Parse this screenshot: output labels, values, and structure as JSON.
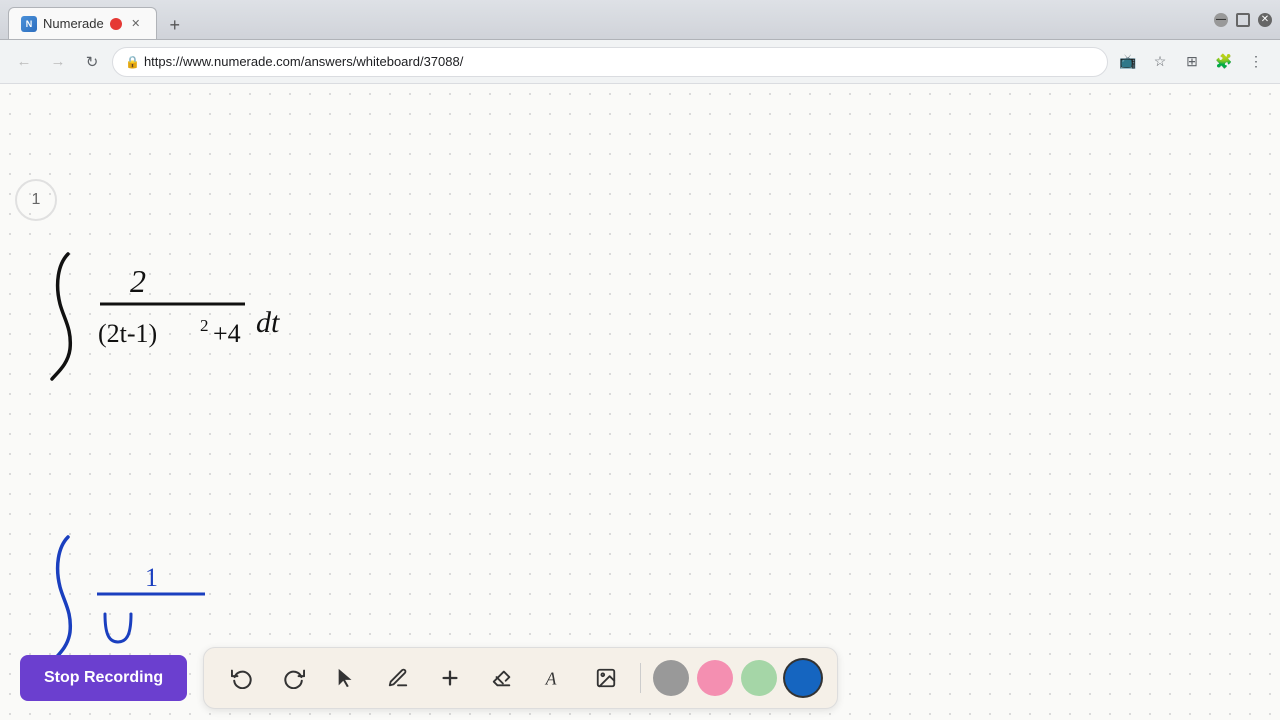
{
  "browser": {
    "tab_title": "Numerade",
    "tab_favicon": "N",
    "url": "https://www.numerade.com/answers/whiteboard/37088/",
    "nav": {
      "back_label": "←",
      "forward_label": "→",
      "reload_label": "↻",
      "home_label": "⌂"
    },
    "toolbar_icons": [
      "📷",
      "★",
      "☰",
      "🔒",
      "⋮"
    ]
  },
  "page": {
    "number": "1"
  },
  "bottom_toolbar": {
    "stop_recording_label": "Stop Recording",
    "tools": [
      {
        "name": "undo",
        "icon": "↩",
        "label": "Undo"
      },
      {
        "name": "redo",
        "icon": "↪",
        "label": "Redo"
      },
      {
        "name": "select",
        "icon": "▲",
        "label": "Select"
      },
      {
        "name": "pencil",
        "icon": "✏",
        "label": "Pencil"
      },
      {
        "name": "add",
        "icon": "+",
        "label": "Add"
      },
      {
        "name": "eraser",
        "icon": "/",
        "label": "Eraser"
      },
      {
        "name": "text",
        "icon": "A",
        "label": "Text"
      },
      {
        "name": "image",
        "icon": "🖼",
        "label": "Image"
      }
    ],
    "colors": [
      {
        "name": "gray",
        "hex": "#999999",
        "active": false
      },
      {
        "name": "pink",
        "hex": "#f48fb1",
        "active": false
      },
      {
        "name": "green",
        "hex": "#a5d6a7",
        "active": false
      },
      {
        "name": "blue",
        "hex": "#1565c0",
        "active": true
      }
    ]
  },
  "colors": {
    "accent_purple": "#6b3fcf",
    "toolbar_bg": "#f5f0e8",
    "whiteboard_bg": "#fafaf8",
    "ink_black": "#111111",
    "ink_blue": "#1a3fbf"
  }
}
